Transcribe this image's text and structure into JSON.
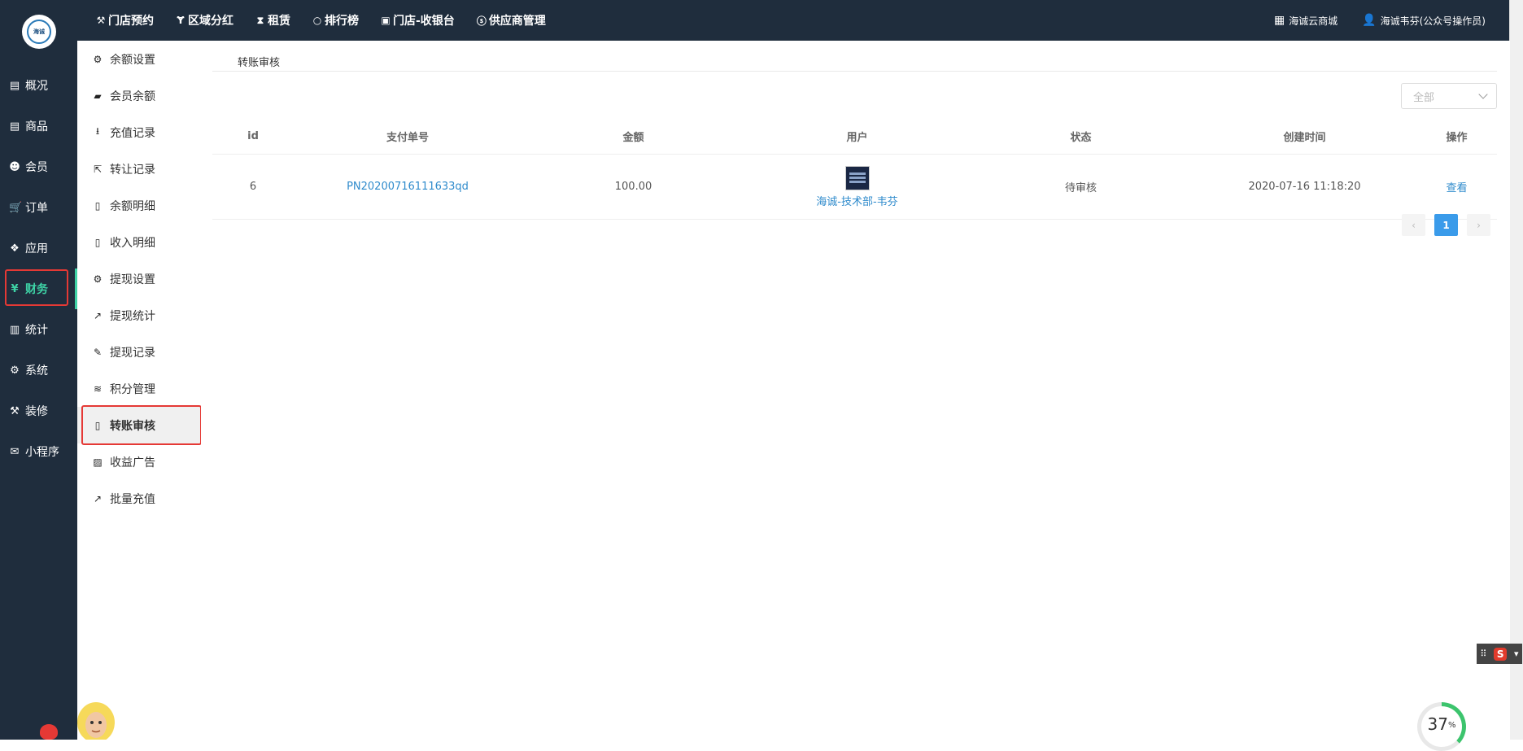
{
  "logo": {
    "text": "海诚"
  },
  "topnav": [
    {
      "icon": "gavel-icon",
      "glyph": "⚒",
      "label": "门店预约"
    },
    {
      "icon": "fork-icon",
      "glyph": "Ɏ",
      "label": "区域分红"
    },
    {
      "icon": "hourglass-icon",
      "glyph": "⧗",
      "label": "租赁"
    },
    {
      "icon": "circle-icon",
      "glyph": "○",
      "label": "排行榜"
    },
    {
      "icon": "cash-icon",
      "glyph": "▣",
      "label": "门店-收银台"
    },
    {
      "icon": "skype-icon",
      "glyph": "ⓢ",
      "label": "供应商管理"
    }
  ],
  "topright": {
    "shop_label": "海诚云商城",
    "user_label": "海诚韦芬(公众号操作员)"
  },
  "sidebar": [
    {
      "icon": "calendar-icon",
      "glyph": "▤",
      "label": "概况"
    },
    {
      "icon": "box-icon",
      "glyph": "▤",
      "label": "商品"
    },
    {
      "icon": "users-icon",
      "glyph": "☻",
      "label": "会员"
    },
    {
      "icon": "cart-icon",
      "glyph": "🛒",
      "label": "订单"
    },
    {
      "icon": "cubes-icon",
      "glyph": "❖",
      "label": "应用"
    },
    {
      "icon": "yen-icon",
      "glyph": "¥",
      "label": "财务",
      "active": true
    },
    {
      "icon": "bar-chart-icon",
      "glyph": "▥",
      "label": "统计"
    },
    {
      "icon": "gears-icon",
      "glyph": "⚙",
      "label": "系统"
    },
    {
      "icon": "gavel-icon",
      "glyph": "⚒",
      "label": "装修"
    },
    {
      "icon": "wechat-icon",
      "glyph": "✉",
      "label": "小程序"
    }
  ],
  "subnav": [
    {
      "icon": "gear-icon",
      "glyph": "⚙",
      "label": "余额设置"
    },
    {
      "icon": "book-icon",
      "glyph": "▰",
      "label": "会员余额"
    },
    {
      "icon": "download-icon",
      "glyph": "⭳",
      "label": "充值记录"
    },
    {
      "icon": "external-link-icon",
      "glyph": "⇱",
      "label": "转让记录"
    },
    {
      "icon": "file-icon",
      "glyph": "▯",
      "label": "余额明细"
    },
    {
      "icon": "file-icon",
      "glyph": "▯",
      "label": "收入明细"
    },
    {
      "icon": "gear-icon",
      "glyph": "⚙",
      "label": "提现设置"
    },
    {
      "icon": "line-chart-icon",
      "glyph": "↗",
      "label": "提现统计"
    },
    {
      "icon": "pencil-icon",
      "glyph": "✎",
      "label": "提现记录"
    },
    {
      "icon": "database-icon",
      "glyph": "≋",
      "label": "积分管理"
    },
    {
      "icon": "file-icon",
      "glyph": "▯",
      "label": "转账审核",
      "active": true
    },
    {
      "icon": "image-icon",
      "glyph": "▨",
      "label": "收益广告"
    },
    {
      "icon": "line-chart-icon",
      "glyph": "↗",
      "label": "批量充值"
    }
  ],
  "main": {
    "breadcrumb": "转账审核",
    "filter": {
      "value": "全部"
    },
    "table": {
      "headers": [
        "id",
        "支付单号",
        "金额",
        "用户",
        "状态",
        "创建时间",
        "操作"
      ],
      "rows": [
        {
          "id": "6",
          "order_no": "PN20200716111633qd",
          "amount": "100.00",
          "user": "海诚-技术部-韦芬",
          "status": "待审核",
          "created": "2020-07-16 11:18:20",
          "action": "查看"
        }
      ]
    },
    "pagination": {
      "prev": "‹",
      "current": "1",
      "next": "›"
    }
  },
  "overlays": {
    "ime_label": "S",
    "gauge_value": "37",
    "gauge_unit": "%"
  },
  "colors": {
    "dark_bg": "#1f2d3d",
    "accent": "#3ed3a6",
    "highlight": "#e53935",
    "link": "#2f8bcc",
    "page_active": "#3a9bea"
  }
}
